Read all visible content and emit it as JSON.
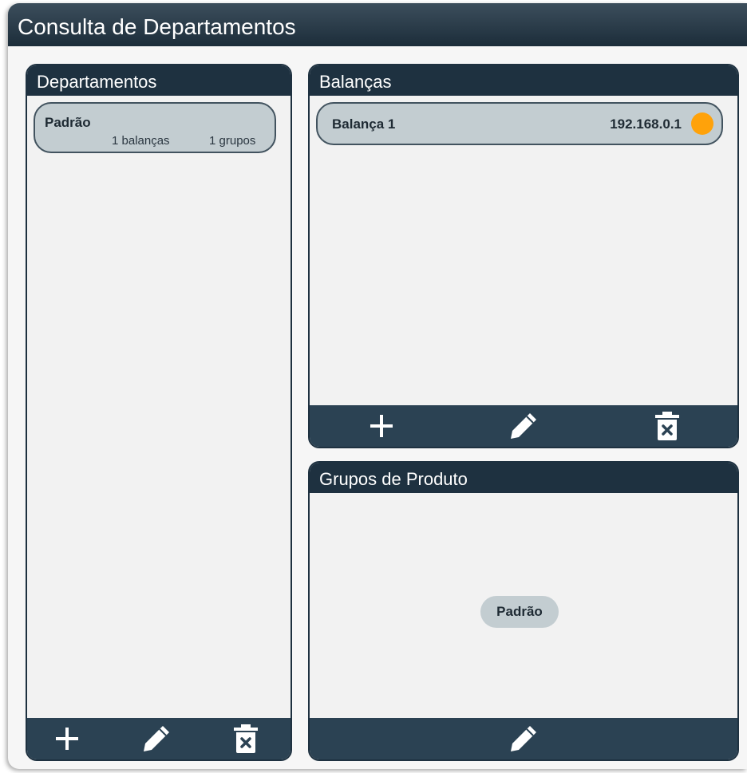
{
  "window": {
    "title": "Consulta de Departamentos"
  },
  "departments_panel": {
    "title": "Departamentos",
    "items": [
      {
        "name": "Padrão",
        "scales_count": "1 balanças",
        "groups_count": "1 grupos"
      }
    ],
    "toolbar": {
      "add_icon": "plus-icon",
      "edit_icon": "pencil-icon",
      "delete_icon": "trash-icon"
    }
  },
  "scales_panel": {
    "title": "Balanças",
    "items": [
      {
        "name": "Balança 1",
        "ip": "192.168.0.1",
        "status_color": "#ffa20a"
      }
    ],
    "toolbar": {
      "add_icon": "plus-icon",
      "edit_icon": "pencil-icon",
      "delete_icon": "trash-icon"
    }
  },
  "groups_panel": {
    "title": "Grupos de Produto",
    "items": [
      {
        "name": "Padrão"
      }
    ],
    "toolbar": {
      "edit_icon": "pencil-icon"
    }
  },
  "colors": {
    "header": "#1e3140",
    "footer": "#2b4253",
    "item_bg": "#c3cdd1",
    "status_warning": "#ffa20a"
  }
}
